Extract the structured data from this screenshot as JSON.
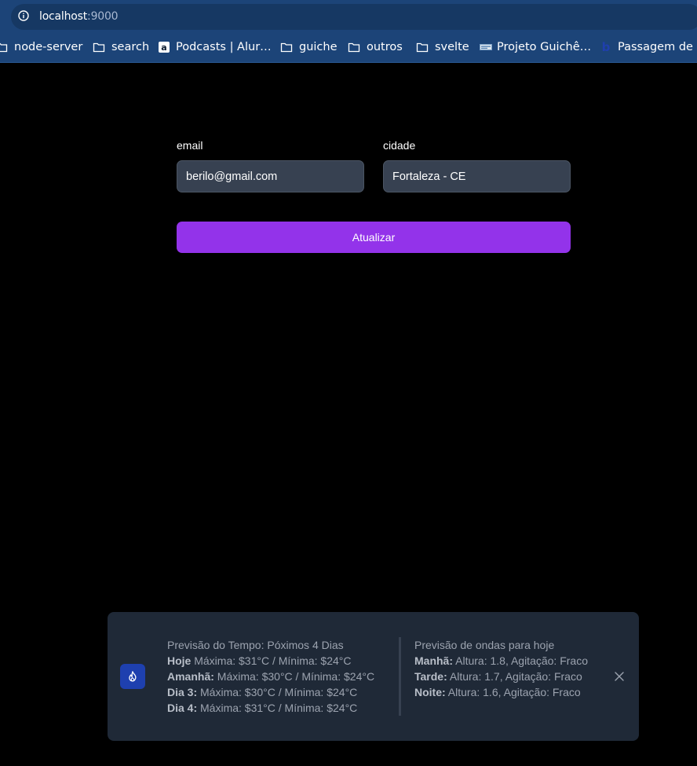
{
  "browser": {
    "url_host": "localhost",
    "url_port": ":9000",
    "bookmarks": [
      {
        "label": "node-server",
        "icon": "folder-icon"
      },
      {
        "label": "search",
        "icon": "folder-icon"
      },
      {
        "label": "Podcasts | Alur…",
        "icon": "alura-favicon"
      },
      {
        "label": "guiche",
        "icon": "folder-icon"
      },
      {
        "label": "outros",
        "icon": "folder-icon"
      },
      {
        "label": "svelte",
        "icon": "folder-icon"
      },
      {
        "label": "Projeto Guichê…",
        "icon": "page-favicon"
      },
      {
        "label": "Passagem de ô…",
        "icon": "b-favicon"
      }
    ]
  },
  "form": {
    "email_label": "email",
    "email_value": "berilo@gmail.com",
    "city_label": "cidade",
    "city_value": "Fortaleza - CE",
    "submit_label": "Atualizar"
  },
  "toast": {
    "icon": "fire-icon",
    "weather": {
      "title": "Previsão do Tempo: Póximos 4 Dias",
      "days": [
        {
          "label": "Hoje",
          "text": "Máxima: $31°C / Mínima: $24°C"
        },
        {
          "label": "Amanhã:",
          "text": "Máxima: $30°C / Mínima: $24°C"
        },
        {
          "label": "Dia 3:",
          "text": "Máxima: $30°C / Mínima: $24°C"
        },
        {
          "label": "Dia 4:",
          "text": "Máxima: $31°C / Mínima: $24°C"
        }
      ]
    },
    "waves": {
      "title": "Previsão de ondas para hoje",
      "periods": [
        {
          "label": "Manhã:",
          "text": "Altura: 1.8, Agitação: Fraco"
        },
        {
          "label": "Tarde:",
          "text": "Altura: 1.7, Agitação: Fraco"
        },
        {
          "label": "Noite:",
          "text": "Altura: 1.6, Agitação: Fraco"
        }
      ]
    }
  },
  "colors": {
    "accent": "#9333ea",
    "browser_bar": "#1c4478",
    "toast_bg": "#1f2937",
    "icon_bg": "#1e40af"
  }
}
